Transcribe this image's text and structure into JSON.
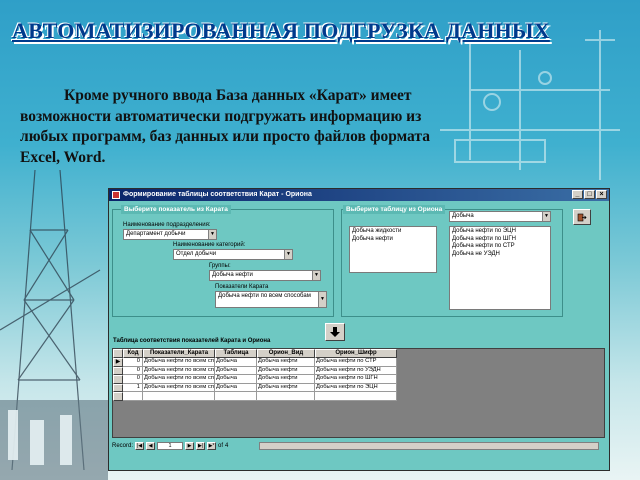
{
  "slide": {
    "title": "АВТОМАТИЗИРОВАННАЯ ПОДГРУЗКА ДАННЫХ",
    "intro": "Кроме ручного ввода База данных «Карат» имеет возможности автоматически подгружать информацию из любых программ, баз данных или просто файлов формата Excel, Word."
  },
  "window": {
    "title": "Формирование таблицы соответствия Карат - Ориона",
    "left_panel": {
      "header": "Выберите показатель из Карата",
      "field1_label": "Наименование подразделения:",
      "field1_value": "Департамент добычи",
      "field2_label": "Наименование категорий:",
      "field2_value": "Отдел добычи",
      "field3_label": "Группы:",
      "field3_value": "Добыча нефти",
      "field4_label": "Показатели Карата",
      "field4_value": "Добыча нефти по всем способам"
    },
    "right_panel": {
      "header": "Выберите таблицу из Ориона",
      "combo_value": "Добыча",
      "list1": [
        "Добыча жидкости",
        "Добыча нефти"
      ],
      "list2": [
        "Добыча нефти по ЭЦН",
        "Добыча нефти по ШГН",
        "Добыча нефти по СТР",
        "Добыча не УЭДН"
      ]
    },
    "table_caption": "Таблица соответствия показателей Карата и Ориона",
    "table": {
      "columns": [
        "Код",
        "Показатели_Карата",
        "Таблица",
        "Орион_Вид",
        "Орион_Шифр"
      ],
      "rows": [
        [
          "0",
          "Добыча нефти по всем способам",
          "Добыча",
          "Добыча нефти",
          "Добыча нефти по СТР"
        ],
        [
          "0",
          "Добыча нефти по всем способам",
          "Добыча",
          "Добыча нефти",
          "Добыча нефти по УЭДН"
        ],
        [
          "0",
          "Добыча нефти по всем способам",
          "Добыча",
          "Добыча нефти",
          "Добыча нефти по ШГН"
        ],
        [
          "1",
          "Добыча нефти по всем способам",
          "Добыча",
          "Добыча нефти",
          "Добыча нефти по ЭЦН"
        ]
      ]
    },
    "navigator": {
      "record_label": "Record:",
      "current": "1",
      "of_label": "of",
      "total": "4"
    }
  }
}
